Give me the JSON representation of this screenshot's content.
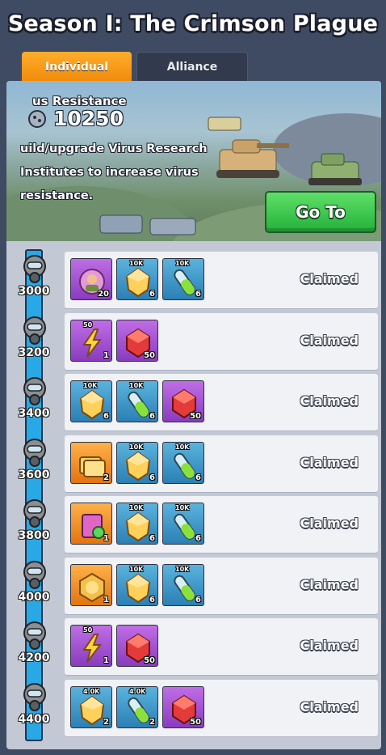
{
  "title": "Season I: The Crimson Plague",
  "tabs": [
    {
      "label": "Individual",
      "active": true
    },
    {
      "label": "Alliance",
      "active": false
    }
  ],
  "banner": {
    "resistance_label": "us Resistance",
    "resistance_value": "10250",
    "description": "uild/upgrade Virus Research Institutes to increase virus resistance.",
    "goto_label": "Go To"
  },
  "colors": {
    "active_tab": "#f59a1a",
    "goto_button": "#3cc64e",
    "track": "#29a8e6",
    "blue_tile": "#3d97c8",
    "purple_tile": "#a556d4",
    "orange_tile": "#f29a2a"
  },
  "milestones": [
    {
      "label": "3000",
      "status": "Claimed",
      "rewards": [
        {
          "icon": "hero-badge-icon",
          "tile": "purple",
          "badge": "",
          "qty": "20"
        },
        {
          "icon": "gold-chunk-icon",
          "tile": "blue",
          "badge": "10K",
          "qty": "6"
        },
        {
          "icon": "green-vial-icon",
          "tile": "blue",
          "badge": "10K",
          "qty": "6"
        }
      ]
    },
    {
      "label": "3200",
      "status": "Claimed",
      "rewards": [
        {
          "icon": "lightning-icon",
          "tile": "purple",
          "badge": "50",
          "qty": "1"
        },
        {
          "icon": "red-gem-icon",
          "tile": "purple",
          "badge": "",
          "qty": "50"
        }
      ]
    },
    {
      "label": "3400",
      "status": "Claimed",
      "rewards": [
        {
          "icon": "gold-chunk-icon",
          "tile": "blue",
          "badge": "10K",
          "qty": "6"
        },
        {
          "icon": "green-vial-icon",
          "tile": "blue",
          "badge": "10K",
          "qty": "6"
        },
        {
          "icon": "red-gem-icon",
          "tile": "purple",
          "badge": "",
          "qty": "50"
        }
      ]
    },
    {
      "label": "3600",
      "status": "Claimed",
      "rewards": [
        {
          "icon": "gold-cards-icon",
          "tile": "orange",
          "badge": "",
          "qty": "2"
        },
        {
          "icon": "gold-chunk-icon",
          "tile": "blue",
          "badge": "10K",
          "qty": "6"
        },
        {
          "icon": "green-vial-icon",
          "tile": "blue",
          "badge": "10K",
          "qty": "6"
        }
      ]
    },
    {
      "label": "3800",
      "status": "Claimed",
      "rewards": [
        {
          "icon": "skill-book-icon",
          "tile": "orange",
          "badge": "",
          "qty": "1"
        },
        {
          "icon": "gold-chunk-icon",
          "tile": "blue",
          "badge": "10K",
          "qty": "6"
        },
        {
          "icon": "green-vial-icon",
          "tile": "blue",
          "badge": "10K",
          "qty": "6"
        }
      ]
    },
    {
      "label": "4000",
      "status": "Claimed",
      "rewards": [
        {
          "icon": "gold-medal-icon",
          "tile": "orange",
          "badge": "",
          "qty": "1"
        },
        {
          "icon": "gold-chunk-icon",
          "tile": "blue",
          "badge": "10K",
          "qty": "6"
        },
        {
          "icon": "green-vial-icon",
          "tile": "blue",
          "badge": "10K",
          "qty": "6"
        }
      ]
    },
    {
      "label": "4200",
      "status": "Claimed",
      "rewards": [
        {
          "icon": "lightning-icon",
          "tile": "purple",
          "badge": "50",
          "qty": "1"
        },
        {
          "icon": "red-gem-icon",
          "tile": "purple",
          "badge": "",
          "qty": "50"
        }
      ]
    },
    {
      "label": "4400",
      "status": "Claimed",
      "rewards": [
        {
          "icon": "gold-chunk-icon",
          "tile": "blue",
          "badge": "4.0K",
          "qty": "2"
        },
        {
          "icon": "green-vial-icon",
          "tile": "blue",
          "badge": "4.0K",
          "qty": "2"
        },
        {
          "icon": "red-gem-icon",
          "tile": "purple",
          "badge": "",
          "qty": "50"
        }
      ]
    }
  ]
}
